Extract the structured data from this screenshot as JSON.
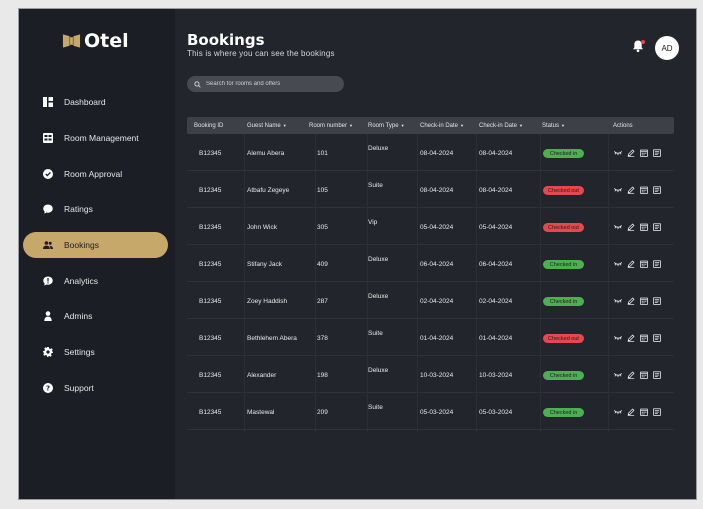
{
  "app": {
    "logo_text": "Otel"
  },
  "sidebar": {
    "items": [
      {
        "label": "Dashboard",
        "icon": "dashboard-icon",
        "active": false
      },
      {
        "label": "Room Management",
        "icon": "room-management-icon",
        "active": false
      },
      {
        "label": "Room Approval",
        "icon": "check-badge-icon",
        "active": false
      },
      {
        "label": "Ratings",
        "icon": "chat-bubble-icon",
        "active": false
      },
      {
        "label": "Bookings",
        "icon": "users-icon",
        "active": true
      },
      {
        "label": "Analytics",
        "icon": "exclamation-bubble-icon",
        "active": false
      },
      {
        "label": "Admins",
        "icon": "person-icon",
        "active": false
      },
      {
        "label": "Settings",
        "icon": "gear-icon",
        "active": false
      },
      {
        "label": "Support",
        "icon": "help-circle-icon",
        "active": false
      }
    ]
  },
  "header": {
    "title": "Bookings",
    "subtitle": "This is where you can see  the bookings",
    "avatar_initials": "AD"
  },
  "search": {
    "placeholder": "Search for rooms and offers"
  },
  "table": {
    "columns": [
      "Booking ID",
      "Guest Name",
      "Room number",
      "Room Type",
      "Check-in Date",
      "Check-in Date",
      "Status",
      "Actions"
    ],
    "rows": [
      {
        "id": "B12345",
        "guest": "Alemu Abera",
        "room": "101",
        "type": "Deluxe",
        "checkin": "08-04-2024",
        "checkout": "08-04-2024",
        "status": "Checked in"
      },
      {
        "id": "B12345",
        "guest": "Atbafu Zegeye",
        "room": "105",
        "type": "Suite",
        "checkin": "08-04-2024",
        "checkout": "08-04-2024",
        "status": "Checked out"
      },
      {
        "id": "B12345",
        "guest": "John Wick",
        "room": "305",
        "type": "Vip",
        "checkin": "05-04-2024",
        "checkout": "05-04-2024",
        "status": "Checked out"
      },
      {
        "id": "B12345",
        "guest": "Stifany Jack",
        "room": "409",
        "type": "Deluxe",
        "checkin": "06-04-2024",
        "checkout": "06-04-2024",
        "status": "Checked in"
      },
      {
        "id": "B12345",
        "guest": "Zoey Haddish",
        "room": "287",
        "type": "Deluxe",
        "checkin": "02-04-2024",
        "checkout": "02-04-2024",
        "status": "Checked in"
      },
      {
        "id": "B12345",
        "guest": "Bethlehem Abera",
        "room": "378",
        "type": "Suite",
        "checkin": "01-04-2024",
        "checkout": "01-04-2024",
        "status": "Checked out"
      },
      {
        "id": "B12345",
        "guest": "Alexander",
        "room": "198",
        "type": "Deluxe",
        "checkin": "10-03-2024",
        "checkout": "10-03-2024",
        "status": "Checked in"
      },
      {
        "id": "B12345",
        "guest": "Mastewal",
        "room": "209",
        "type": "Suite",
        "checkin": "05-03-2024",
        "checkout": "05-03-2024",
        "status": "Checked in"
      }
    ]
  },
  "colors": {
    "accent": "#c6a86b",
    "checked_in": "#4caf50",
    "checked_out": "#e5484d"
  }
}
